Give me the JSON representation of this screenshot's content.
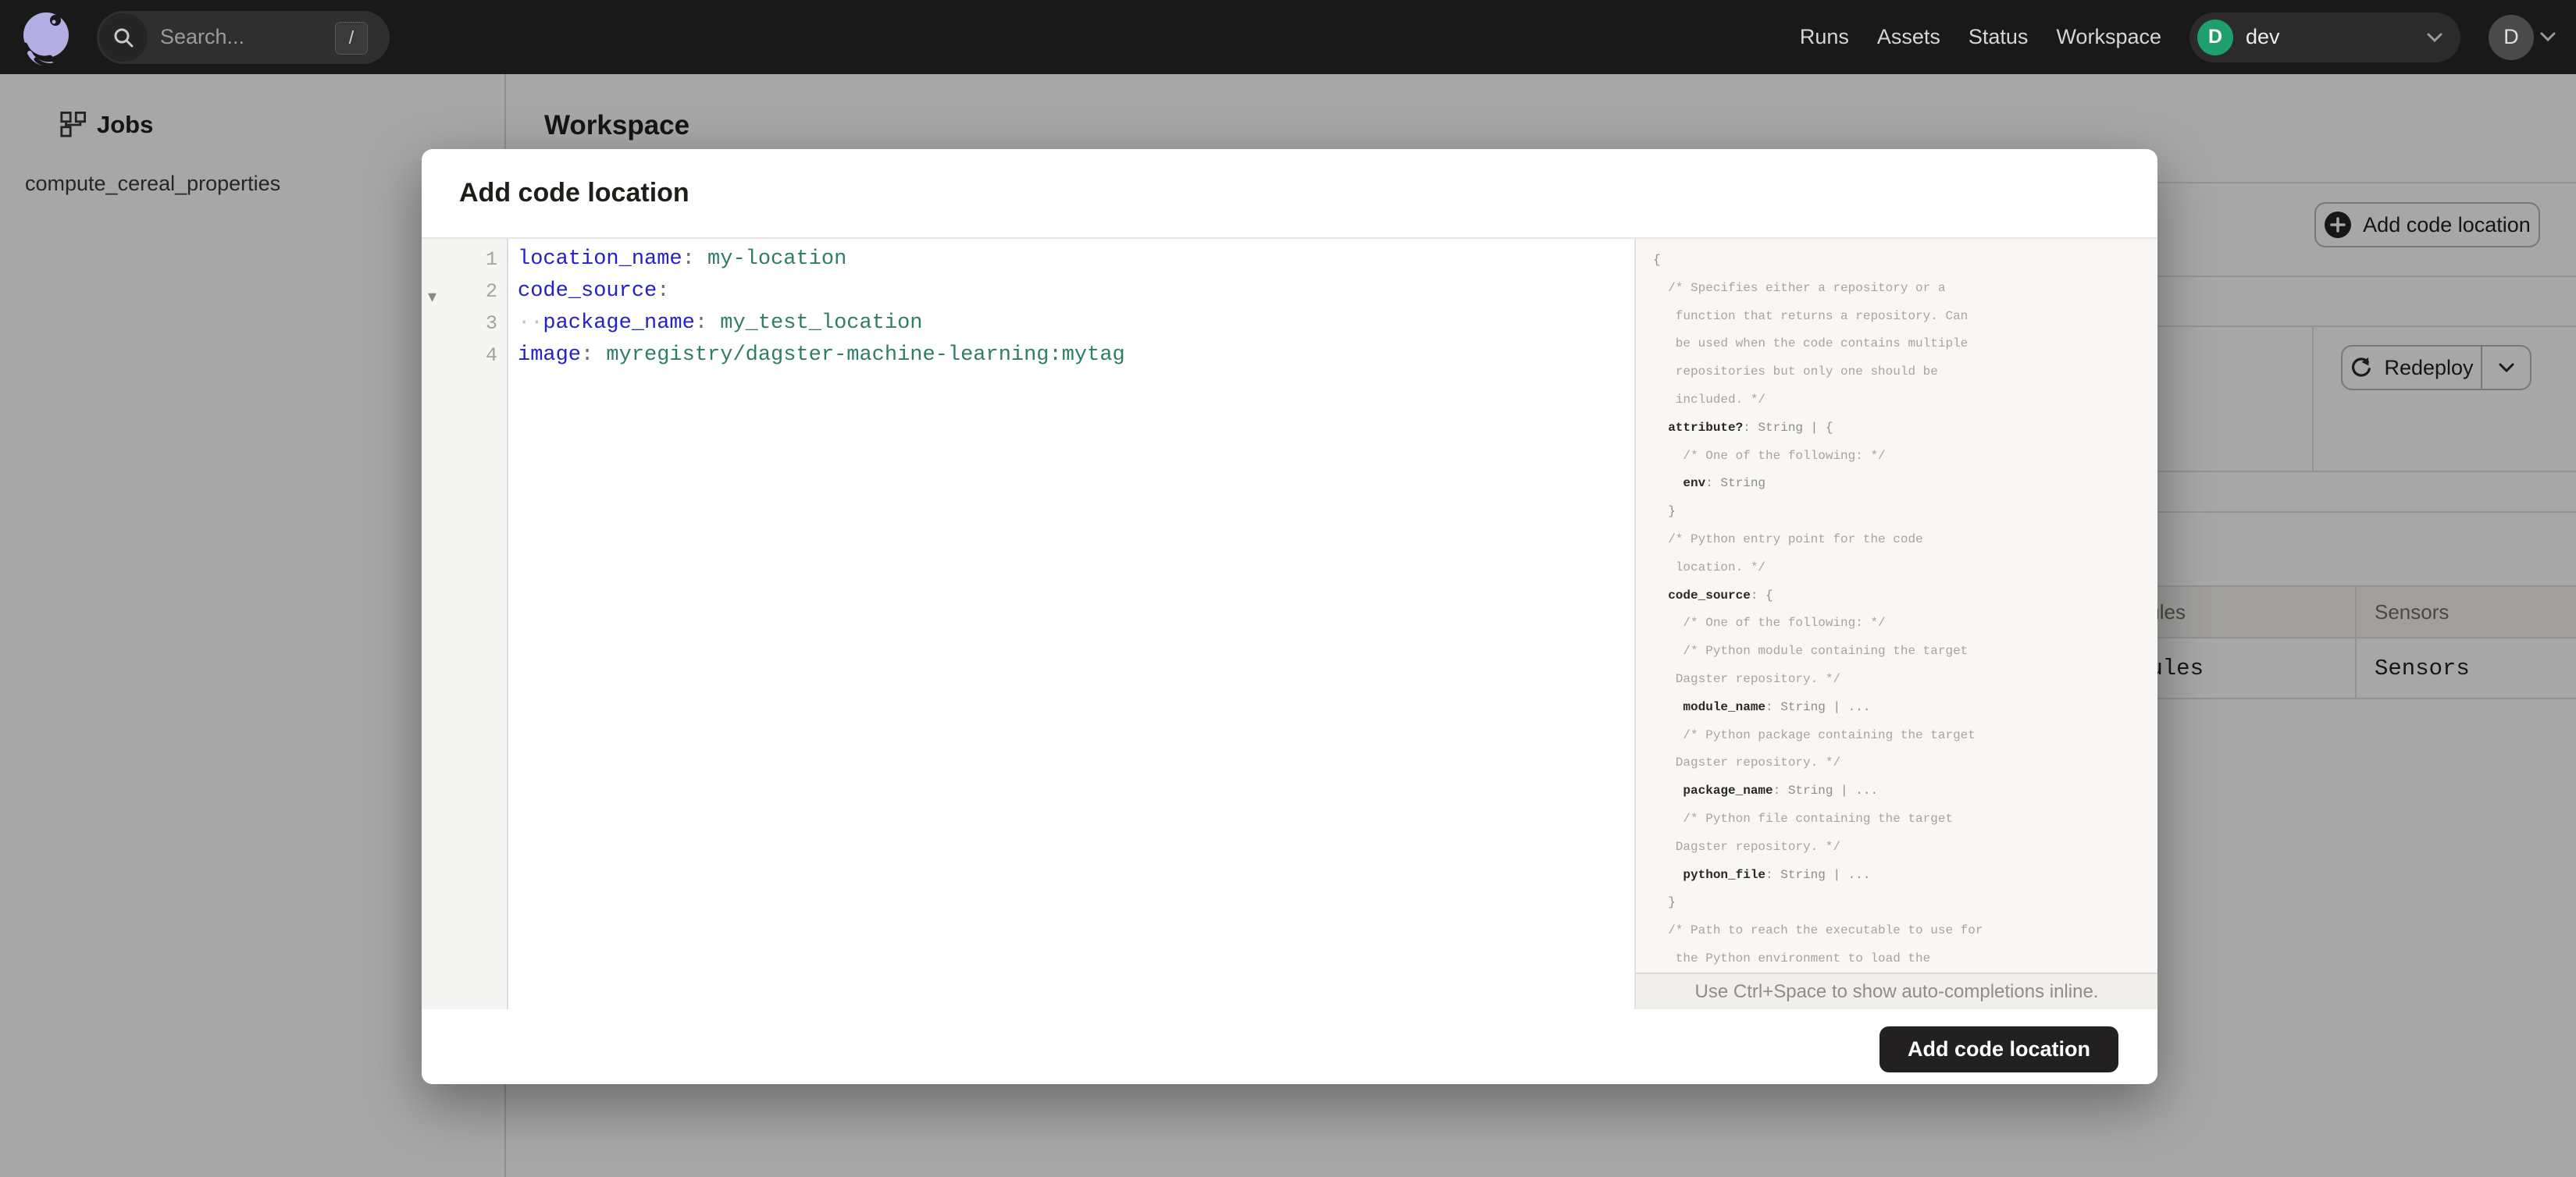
{
  "topbar": {
    "search": {
      "placeholder": "Search...",
      "shortcut_key": "/"
    },
    "nav": [
      "Runs",
      "Assets",
      "Status",
      "Workspace"
    ],
    "deployment": {
      "initial": "D",
      "name": "dev",
      "badge_color": "#1f9e6e"
    },
    "user": {
      "initial": "D"
    }
  },
  "sidebar": {
    "section_label": "Jobs",
    "items": [
      {
        "label": "compute_cereal_properties"
      }
    ]
  },
  "workspace": {
    "title": "Workspace",
    "add_button_label": "Add code location",
    "redeploy_label": "Redeploy",
    "table": {
      "headers": [
        "Schedules",
        "Sensors"
      ],
      "row": [
        "Schedules",
        "Sensors"
      ]
    }
  },
  "modal": {
    "title": "Add code location",
    "submit_label": "Add code location",
    "hint": "Use Ctrl+Space to show auto-completions inline.",
    "editor": {
      "fold_arrow": "▾",
      "syntax_colors": {
        "key": "#2321c8",
        "value": "#2f7d66",
        "punctuation": "#6f6d68"
      },
      "lines": [
        [
          [
            "k",
            "location_name"
          ],
          [
            "p",
            ": "
          ],
          [
            "v",
            "my-location"
          ]
        ],
        [
          [
            "k",
            "code_source"
          ],
          [
            "p",
            ":"
          ]
        ],
        [
          [
            "w",
            "··"
          ],
          [
            "k",
            "package_name"
          ],
          [
            "p",
            ": "
          ],
          [
            "v",
            "my_test_location"
          ]
        ],
        [
          [
            "k",
            "image"
          ],
          [
            "p",
            ": "
          ],
          [
            "v",
            "myregistry/dagster-machine-learning:mytag"
          ]
        ]
      ]
    },
    "schema": {
      "lines": [
        [
          [
            "p",
            "{"
          ]
        ],
        [
          [
            "c",
            "  /* Specifies either a repository or a"
          ]
        ],
        [
          [
            "c",
            "   function that returns a repository. Can"
          ]
        ],
        [
          [
            "c",
            "   be used when the code contains multiple"
          ]
        ],
        [
          [
            "c",
            "   repositories but only one should be"
          ]
        ],
        [
          [
            "c",
            "   included. */"
          ]
        ],
        [
          [
            "k",
            "  attribute?"
          ],
          [
            "p",
            ": String | {"
          ]
        ],
        [
          [
            "c",
            "    /* One of the following: */"
          ]
        ],
        [
          [
            "k",
            "    env"
          ],
          [
            "p",
            ": String"
          ]
        ],
        [
          [
            "p",
            "  }"
          ]
        ],
        [
          [
            "c",
            "  /* Python entry point for the code"
          ]
        ],
        [
          [
            "c",
            "   location. */"
          ]
        ],
        [
          [
            "k",
            "  code_source"
          ],
          [
            "p",
            ": {"
          ]
        ],
        [
          [
            "c",
            "    /* One of the following: */"
          ]
        ],
        [
          [
            "c",
            "    /* Python module containing the target"
          ]
        ],
        [
          [
            "c",
            "   Dagster repository. */"
          ]
        ],
        [
          [
            "k",
            "    module_name"
          ],
          [
            "p",
            ": String | ..."
          ]
        ],
        [
          [
            "c",
            "    /* Python package containing the target"
          ]
        ],
        [
          [
            "c",
            "   Dagster repository. */"
          ]
        ],
        [
          [
            "k",
            "    package_name"
          ],
          [
            "p",
            ": String | ..."
          ]
        ],
        [
          [
            "c",
            "    /* Python file containing the target"
          ]
        ],
        [
          [
            "c",
            "   Dagster repository. */"
          ]
        ],
        [
          [
            "k",
            "    python_file"
          ],
          [
            "p",
            ": String | ..."
          ]
        ],
        [
          [
            "p",
            "  }"
          ]
        ],
        [
          [
            "c",
            "  /* Path to reach the executable to use for"
          ]
        ],
        [
          [
            "c",
            "   the Python environment to load the"
          ]
        ]
      ]
    }
  }
}
